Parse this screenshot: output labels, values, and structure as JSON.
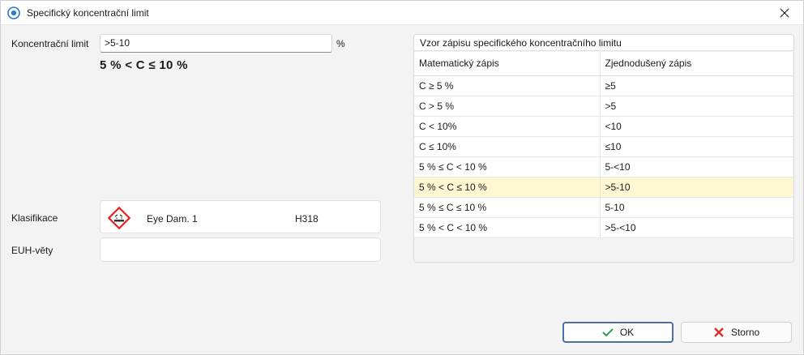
{
  "window": {
    "title": "Specifický koncentrační limit"
  },
  "form": {
    "concentration_label": "Koncentrační limit",
    "concentration_value": ">5-10",
    "concentration_unit": "%",
    "formula_display": "5 % < C ≤ 10 %",
    "classification_label": "Klasifikace",
    "classification": {
      "name": "Eye Dam. 1",
      "code": "H318",
      "icon": "corrosion-pictogram"
    },
    "euh_label": "EUH-věty",
    "euh_value": ""
  },
  "reference": {
    "title": "Vzor zápisu specifického koncentračního limitu",
    "columns": [
      "Matematický zápis",
      "Zjednodušený zápis"
    ],
    "rows": [
      {
        "math": "C ≥ 5 %",
        "simple": "≥5"
      },
      {
        "math": "C > 5 %",
        "simple": ">5"
      },
      {
        "math": "C < 10%",
        "simple": "<10"
      },
      {
        "math": "C ≤ 10%",
        "simple": "≤10"
      },
      {
        "math": "5 % ≤ C < 10 %",
        "simple": "5-<10"
      },
      {
        "math": "5 % < C ≤ 10 %",
        "simple": ">5-10"
      },
      {
        "math": "5 % ≤ C ≤ 10 %",
        "simple": "5-10"
      },
      {
        "math": "5 % < C < 10 %",
        "simple": ">5-<10"
      }
    ],
    "selected_row": 5
  },
  "buttons": {
    "ok_label": "OK",
    "cancel_label": "Storno"
  },
  "colors": {
    "selected_row": "#fff7d1",
    "ok_icon": "#2e9e4f",
    "cancel_icon": "#d9302c",
    "hazard_red": "#e3241b",
    "primary_border": "#4a6fa5"
  }
}
